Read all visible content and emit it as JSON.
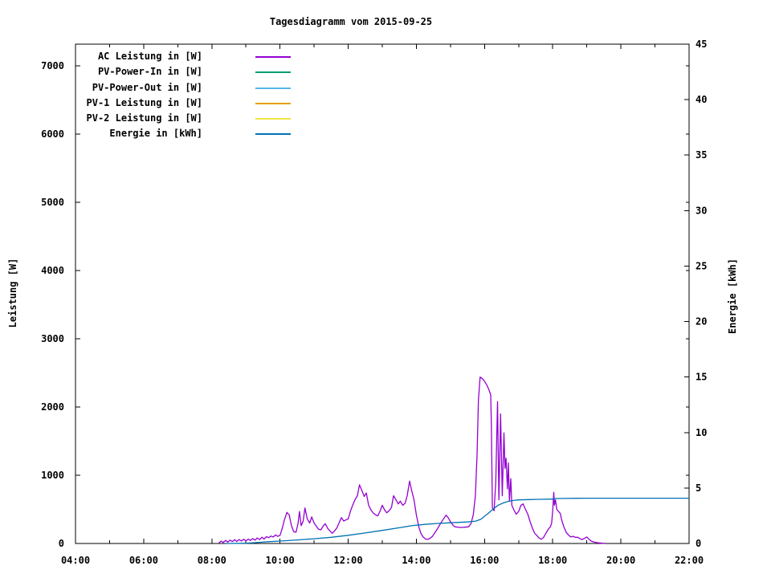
{
  "page": {
    "title": "Tagesdiagramm vom 2015-09-25"
  },
  "chart_data": {
    "type": "line",
    "title": "Tagesdiagramm vom 2015-09-25",
    "x_axis": {
      "range_hours": [
        4,
        22
      ],
      "minor_tick_every_hours": 1,
      "major_ticks": [
        {
          "hour": 4,
          "label": "04:00"
        },
        {
          "hour": 6,
          "label": "06:00"
        },
        {
          "hour": 8,
          "label": "08:00"
        },
        {
          "hour": 10,
          "label": "10:00"
        },
        {
          "hour": 12,
          "label": "12:00"
        },
        {
          "hour": 14,
          "label": "14:00"
        },
        {
          "hour": 16,
          "label": "16:00"
        },
        {
          "hour": 18,
          "label": "18:00"
        },
        {
          "hour": 20,
          "label": "20:00"
        },
        {
          "hour": 22,
          "label": "22:00"
        }
      ]
    },
    "y_left_axis": {
      "label": "Leistung [W]",
      "ticks": [
        0,
        1000,
        2000,
        3000,
        4000,
        5000,
        6000,
        7000
      ],
      "range": [
        0,
        7320
      ]
    },
    "y_right_axis": {
      "label": "Energie [kWh]",
      "ticks": [
        0,
        5,
        10,
        15,
        20,
        25,
        30,
        35,
        40,
        45
      ],
      "range": [
        0,
        45
      ]
    },
    "legend": [
      {
        "label": "AC Leistung in [W]",
        "color": "#9400d3"
      },
      {
        "label": "PV-Power-In in [W]",
        "color": "#009e73"
      },
      {
        "label": "PV-Power-Out in [W]",
        "color": "#56b4e9"
      },
      {
        "label": "PV-1 Leistung in [W]",
        "color": "#e69f00"
      },
      {
        "label": "PV-2 Leistung in [W]",
        "color": "#f0e442"
      },
      {
        "label": "Energie in [kWh]",
        "color": "#0072b2"
      }
    ],
    "series": [
      {
        "name": "AC Leistung in [W]",
        "color": "#9400d3",
        "axis": "left",
        "points": [
          [
            8.2,
            2
          ],
          [
            8.27,
            35
          ],
          [
            8.33,
            15
          ],
          [
            8.4,
            45
          ],
          [
            8.47,
            20
          ],
          [
            8.53,
            50
          ],
          [
            8.6,
            28
          ],
          [
            8.67,
            55
          ],
          [
            8.73,
            30
          ],
          [
            8.8,
            58
          ],
          [
            8.87,
            35
          ],
          [
            8.93,
            62
          ],
          [
            9.0,
            38
          ],
          [
            9.07,
            65
          ],
          [
            9.13,
            45
          ],
          [
            9.2,
            72
          ],
          [
            9.27,
            50
          ],
          [
            9.33,
            80
          ],
          [
            9.4,
            58
          ],
          [
            9.47,
            92
          ],
          [
            9.53,
            65
          ],
          [
            9.6,
            100
          ],
          [
            9.67,
            85
          ],
          [
            9.73,
            110
          ],
          [
            9.8,
            95
          ],
          [
            9.87,
            125
          ],
          [
            9.93,
            105
          ],
          [
            10.0,
            120
          ],
          [
            10.07,
            230
          ],
          [
            10.13,
            350
          ],
          [
            10.2,
            455
          ],
          [
            10.27,
            420
          ],
          [
            10.33,
            270
          ],
          [
            10.4,
            175
          ],
          [
            10.47,
            165
          ],
          [
            10.53,
            300
          ],
          [
            10.57,
            470
          ],
          [
            10.62,
            260
          ],
          [
            10.68,
            330
          ],
          [
            10.73,
            520
          ],
          [
            10.8,
            360
          ],
          [
            10.87,
            300
          ],
          [
            10.93,
            390
          ],
          [
            11.0,
            300
          ],
          [
            11.07,
            250
          ],
          [
            11.13,
            210
          ],
          [
            11.2,
            200
          ],
          [
            11.27,
            260
          ],
          [
            11.33,
            290
          ],
          [
            11.4,
            220
          ],
          [
            11.47,
            180
          ],
          [
            11.53,
            150
          ],
          [
            11.6,
            185
          ],
          [
            11.67,
            230
          ],
          [
            11.73,
            300
          ],
          [
            11.8,
            380
          ],
          [
            11.87,
            330
          ],
          [
            11.93,
            345
          ],
          [
            12.0,
            360
          ],
          [
            12.07,
            480
          ],
          [
            12.13,
            560
          ],
          [
            12.2,
            640
          ],
          [
            12.27,
            700
          ],
          [
            12.33,
            860
          ],
          [
            12.4,
            780
          ],
          [
            12.47,
            690
          ],
          [
            12.53,
            740
          ],
          [
            12.6,
            560
          ],
          [
            12.67,
            490
          ],
          [
            12.73,
            450
          ],
          [
            12.8,
            420
          ],
          [
            12.87,
            405
          ],
          [
            12.93,
            470
          ],
          [
            13.0,
            560
          ],
          [
            13.07,
            490
          ],
          [
            13.13,
            450
          ],
          [
            13.2,
            480
          ],
          [
            13.27,
            530
          ],
          [
            13.33,
            700
          ],
          [
            13.4,
            640
          ],
          [
            13.47,
            580
          ],
          [
            13.53,
            620
          ],
          [
            13.6,
            560
          ],
          [
            13.67,
            590
          ],
          [
            13.73,
            700
          ],
          [
            13.8,
            915
          ],
          [
            13.87,
            760
          ],
          [
            13.93,
            640
          ],
          [
            14.0,
            420
          ],
          [
            14.07,
            250
          ],
          [
            14.13,
            150
          ],
          [
            14.2,
            95
          ],
          [
            14.27,
            65
          ],
          [
            14.33,
            60
          ],
          [
            14.4,
            75
          ],
          [
            14.47,
            105
          ],
          [
            14.6,
            200
          ],
          [
            14.73,
            310
          ],
          [
            14.87,
            415
          ],
          [
            14.93,
            380
          ],
          [
            15.0,
            320
          ],
          [
            15.07,
            270
          ],
          [
            15.13,
            245
          ],
          [
            15.27,
            235
          ],
          [
            15.4,
            238
          ],
          [
            15.53,
            245
          ],
          [
            15.6,
            290
          ],
          [
            15.67,
            420
          ],
          [
            15.73,
            700
          ],
          [
            15.78,
            1300
          ],
          [
            15.82,
            2100
          ],
          [
            15.87,
            2440
          ],
          [
            15.93,
            2420
          ],
          [
            16.0,
            2380
          ],
          [
            16.07,
            2320
          ],
          [
            16.13,
            2250
          ],
          [
            16.18,
            2180
          ],
          [
            16.2,
            1750
          ],
          [
            16.23,
            520
          ],
          [
            16.28,
            480
          ],
          [
            16.33,
            900
          ],
          [
            16.38,
            2080
          ],
          [
            16.42,
            640
          ],
          [
            16.47,
            1900
          ],
          [
            16.52,
            700
          ],
          [
            16.57,
            1620
          ],
          [
            16.6,
            1100
          ],
          [
            16.63,
            1250
          ],
          [
            16.67,
            800
          ],
          [
            16.7,
            1180
          ],
          [
            16.73,
            620
          ],
          [
            16.77,
            950
          ],
          [
            16.8,
            560
          ],
          [
            16.87,
            480
          ],
          [
            16.93,
            430
          ],
          [
            17.0,
            470
          ],
          [
            17.07,
            560
          ],
          [
            17.13,
            580
          ],
          [
            17.2,
            500
          ],
          [
            17.27,
            430
          ],
          [
            17.33,
            330
          ],
          [
            17.4,
            230
          ],
          [
            17.47,
            150
          ],
          [
            17.53,
            120
          ],
          [
            17.6,
            80
          ],
          [
            17.67,
            62
          ],
          [
            17.73,
            90
          ],
          [
            17.8,
            150
          ],
          [
            17.87,
            210
          ],
          [
            17.93,
            245
          ],
          [
            17.97,
            300
          ],
          [
            18.0,
            480
          ],
          [
            18.03,
            750
          ],
          [
            18.05,
            560
          ],
          [
            18.08,
            640
          ],
          [
            18.12,
            500
          ],
          [
            18.17,
            470
          ],
          [
            18.22,
            440
          ],
          [
            18.27,
            330
          ],
          [
            18.33,
            240
          ],
          [
            18.4,
            160
          ],
          [
            18.47,
            120
          ],
          [
            18.53,
            95
          ],
          [
            18.6,
            105
          ],
          [
            18.67,
            88
          ],
          [
            18.73,
            92
          ],
          [
            18.8,
            70
          ],
          [
            18.87,
            58
          ],
          [
            18.93,
            75
          ],
          [
            19.0,
            95
          ],
          [
            19.07,
            60
          ],
          [
            19.13,
            35
          ],
          [
            19.2,
            22
          ],
          [
            19.27,
            15
          ],
          [
            19.33,
            10
          ],
          [
            19.45,
            4
          ],
          [
            19.55,
            2
          ]
        ]
      },
      {
        "name": "PV-Power-In in [W]",
        "color": "#009e73",
        "axis": "left",
        "points": []
      },
      {
        "name": "PV-Power-Out in [W]",
        "color": "#56b4e9",
        "axis": "left",
        "points": []
      },
      {
        "name": "PV-1 Leistung in [W]",
        "color": "#e69f00",
        "axis": "left",
        "points": []
      },
      {
        "name": "PV-2 Leistung in [W]",
        "color": "#f0e442",
        "axis": "left",
        "points": []
      },
      {
        "name": "Energie in [kWh]",
        "color": "#0072b2",
        "axis": "right",
        "points": [
          [
            8.4,
            0
          ],
          [
            9.0,
            0.02
          ],
          [
            9.3,
            0.08
          ],
          [
            9.7,
            0.17
          ],
          [
            10.0,
            0.22
          ],
          [
            10.5,
            0.32
          ],
          [
            11.0,
            0.43
          ],
          [
            11.5,
            0.56
          ],
          [
            12.0,
            0.74
          ],
          [
            12.5,
            0.95
          ],
          [
            13.0,
            1.18
          ],
          [
            13.5,
            1.42
          ],
          [
            13.85,
            1.6
          ],
          [
            14.25,
            1.72
          ],
          [
            14.6,
            1.8
          ],
          [
            15.0,
            1.87
          ],
          [
            15.5,
            1.94
          ],
          [
            15.75,
            2.02
          ],
          [
            15.9,
            2.2
          ],
          [
            16.0,
            2.45
          ],
          [
            16.1,
            2.7
          ],
          [
            16.25,
            3.1
          ],
          [
            16.4,
            3.45
          ],
          [
            16.55,
            3.65
          ],
          [
            16.7,
            3.8
          ],
          [
            16.85,
            3.88
          ],
          [
            17.0,
            3.93
          ],
          [
            17.3,
            3.96
          ],
          [
            17.6,
            3.98
          ],
          [
            18.0,
            4.0
          ],
          [
            18.06,
            4.05
          ],
          [
            18.3,
            4.06
          ],
          [
            18.7,
            4.07
          ],
          [
            19.0,
            4.08
          ],
          [
            22.0,
            4.08
          ]
        ]
      }
    ]
  }
}
